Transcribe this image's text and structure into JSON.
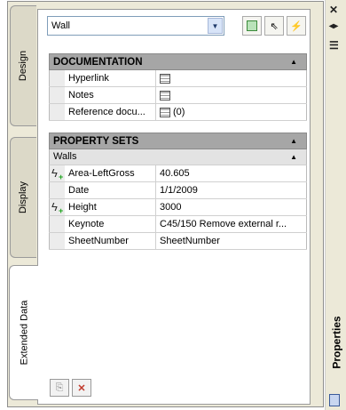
{
  "tabs": [
    {
      "label": "Design"
    },
    {
      "label": "Display"
    },
    {
      "label": "Extended Data"
    }
  ],
  "object_select": {
    "value": "Wall"
  },
  "sections": {
    "documentation": {
      "title": "DOCUMENTATION",
      "rows": [
        {
          "name": "Hyperlink",
          "value": ""
        },
        {
          "name": "Notes",
          "value": ""
        },
        {
          "name": "Reference docu...",
          "value": "(0)"
        }
      ]
    },
    "property_sets": {
      "title": "PROPERTY SETS",
      "group": "Walls",
      "rows": [
        {
          "name": "Area-LeftGross",
          "value": "40.605"
        },
        {
          "name": "Date",
          "value": "1/1/2009"
        },
        {
          "name": "Height",
          "value": "3000"
        },
        {
          "name": "Keynote",
          "value": "C45/150 Remove external r..."
        },
        {
          "name": "SheetNumber",
          "value": "SheetNumber"
        }
      ]
    }
  },
  "palette_title": "Properties",
  "icons": {
    "close": "close-icon",
    "autohide": "autohide-icon",
    "menu": "menu-icon",
    "dropdown": "chevron-down-icon",
    "collapse": "collapse-up-icon"
  }
}
